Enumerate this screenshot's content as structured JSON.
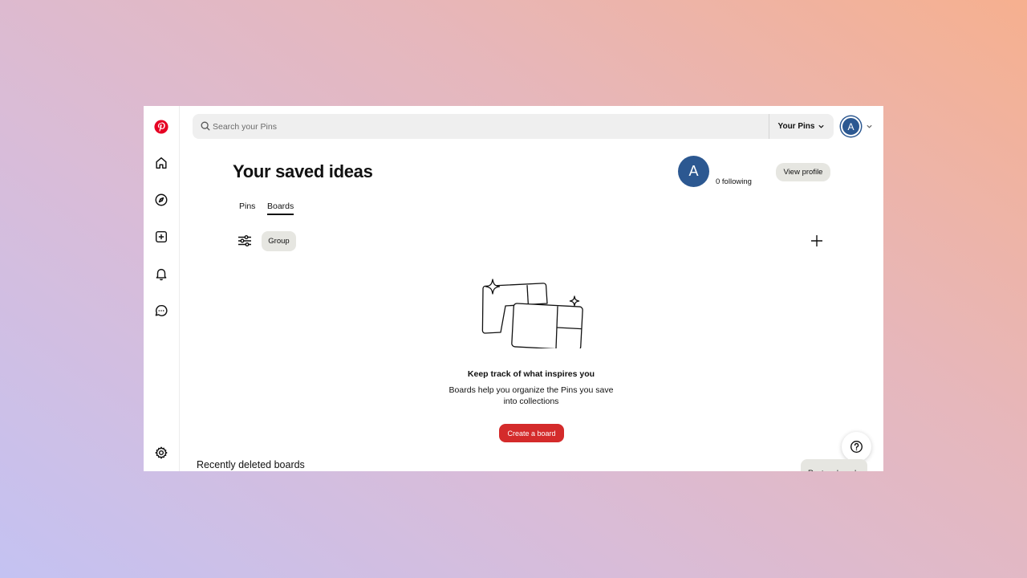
{
  "search": {
    "placeholder": "Search your Pins"
  },
  "header": {
    "pins_dropdown_label": "Your Pins",
    "avatar_letter": "A"
  },
  "profile": {
    "title": "Your saved ideas",
    "avatar_letter": "A",
    "following_text": "0 following",
    "view_profile_label": "View profile"
  },
  "tabs": [
    {
      "label": "Pins",
      "active": false
    },
    {
      "label": "Boards",
      "active": true
    }
  ],
  "toolbar": {
    "group_label": "Group"
  },
  "empty_state": {
    "title": "Keep track of what inspires you",
    "description": "Boards help you organize the Pins you save into collections",
    "create_label": "Create a board"
  },
  "recently_deleted": {
    "title": "Recently deleted boards",
    "restore_label": "Restore boards"
  },
  "sidebar": {
    "items": [
      {
        "icon": "pinterest-logo-icon"
      },
      {
        "icon": "home-icon"
      },
      {
        "icon": "explore-icon"
      },
      {
        "icon": "create-icon"
      },
      {
        "icon": "notifications-icon"
      },
      {
        "icon": "messages-icon"
      },
      {
        "icon": "settings-icon"
      }
    ]
  },
  "colors": {
    "brand_red": "#e60023",
    "create_button": "#d42b2b",
    "avatar_blue": "#2c5891",
    "secondary_button": "#e6e6e1"
  }
}
